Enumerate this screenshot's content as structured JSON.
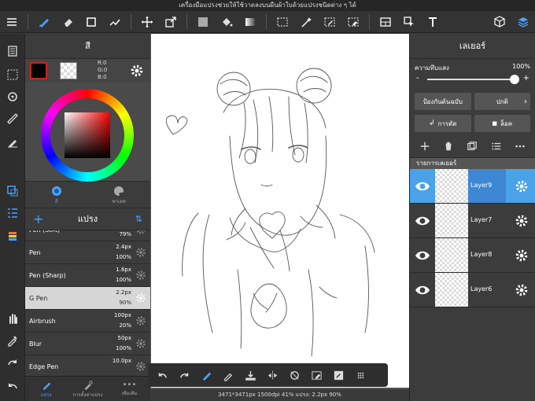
{
  "topbar": {
    "notice": "เครื่องมือแปรงช่วยให้ใช้วาดลงบนผืนผ้าใบด้วยแปรงชนิดต่าง ๆ ได้"
  },
  "color_panel": {
    "title": "สี",
    "rgb": {
      "r": "R:0",
      "g": "G:0",
      "b": "B:0"
    },
    "tabs": [
      {
        "label": "สี"
      },
      {
        "label": "พาเลท"
      }
    ]
  },
  "brush_panel": {
    "title": "แปรง",
    "brushes": [
      {
        "name": "Pen (Soft)",
        "size": "",
        "opacity": "79%"
      },
      {
        "name": "Pen",
        "size": "2.4px",
        "opacity": "100%"
      },
      {
        "name": "Pen (Sharp)",
        "size": "1.6px",
        "opacity": "100%"
      },
      {
        "name": "G Pen",
        "size": "2.2px",
        "opacity": "90%"
      },
      {
        "name": "Airbrush",
        "size": "100px",
        "opacity": "20%"
      },
      {
        "name": "Blur",
        "size": "50px",
        "opacity": "100%"
      },
      {
        "name": "Edge Pen",
        "size": "10.0px",
        "opacity": ""
      }
    ]
  },
  "left_bottom": {
    "tabs": [
      {
        "label": "แปรง"
      },
      {
        "label": "การตั้งค่าแปรง"
      },
      {
        "label": "เพิ่มเติม"
      }
    ]
  },
  "canvas": {
    "status": "3471*3471px 1500dpi 41% แปรง: 2.2px 90%"
  },
  "layer_panel": {
    "title": "เลเยอร์",
    "opacity_label": "ความทึบแสง",
    "opacity_value": "100%",
    "opacity": 1.0,
    "minus": "-",
    "plus": "+",
    "protect_label": "ป้องกันต้นฉบับ",
    "blend_label": "ปกติ",
    "clip_label": "การตัด",
    "lock_label": "ล็อค",
    "list_header": "รายการเลเยอร์",
    "layers": [
      {
        "name": "Layer9"
      },
      {
        "name": "Layer7"
      },
      {
        "name": "Layer8"
      },
      {
        "name": "Layer6"
      }
    ]
  },
  "colors": {
    "accent": "#4aa3e8",
    "selected_layer": "#4aa3e8",
    "fg_color": "#000000"
  }
}
